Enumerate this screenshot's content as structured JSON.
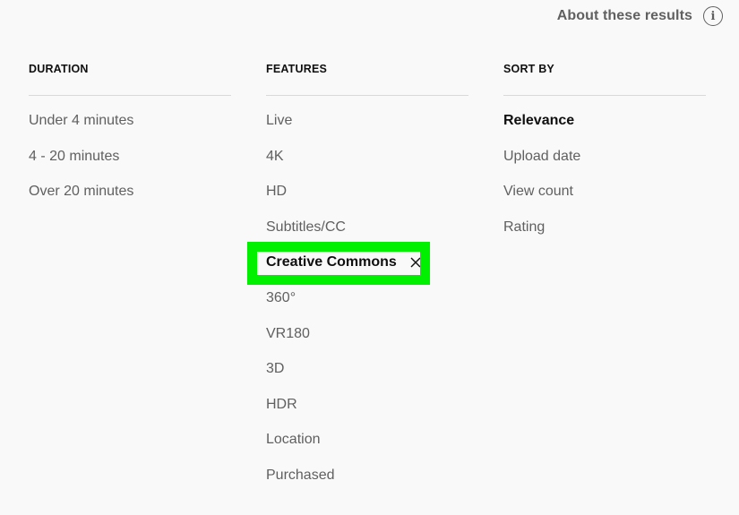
{
  "header": {
    "about_label": "About these results",
    "info_icon": "info-icon"
  },
  "columns": {
    "duration": {
      "title": "DURATION",
      "items": [
        "Under 4 minutes",
        "4 - 20 minutes",
        "Over 20 minutes"
      ]
    },
    "features": {
      "title": "FEATURES",
      "items": [
        "Live",
        "4K",
        "HD",
        "Subtitles/CC",
        "Creative Commons",
        "360°",
        "VR180",
        "3D",
        "HDR",
        "Location",
        "Purchased"
      ],
      "active_item": "Creative Commons",
      "active_icon": "close-icon"
    },
    "sort_by": {
      "title": "SORT BY",
      "items": [
        "Relevance",
        "Upload date",
        "View count",
        "Rating"
      ],
      "selected_item": "Relevance"
    }
  },
  "colors": {
    "highlight": "#00f000",
    "text_primary": "#0f0f0f",
    "text_secondary": "#606060",
    "divider": "#d9d9d9",
    "background": "#f9f9f9"
  }
}
